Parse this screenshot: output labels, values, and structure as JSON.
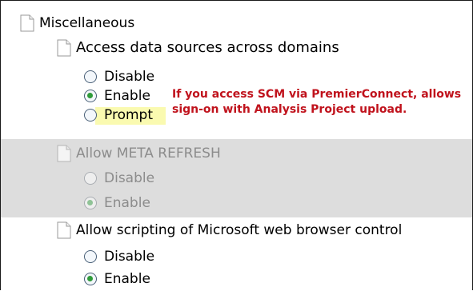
{
  "tree": {
    "root": {
      "label": "Miscellaneous"
    },
    "settings": [
      {
        "label": "Access data sources across domains",
        "options": [
          "Disable",
          "Enable",
          "Prompt"
        ],
        "selected": "Enable"
      },
      {
        "label": "Allow META REFRESH",
        "options": [
          "Disable",
          "Enable"
        ],
        "selected": "Enable",
        "disabled": true
      },
      {
        "label": "Allow scripting of Microsoft web browser control",
        "options": [
          "Disable",
          "Enable"
        ],
        "selected": "Enable"
      }
    ]
  },
  "annotation": {
    "text": "If you access SCM via PremierConnect, allows sign-on with Analysis Project upload.",
    "color": "#c0121c"
  },
  "colors": {
    "highlight": "#fafab0",
    "disabled_band": "#dddddd",
    "radio_checked": "#2f9b3a"
  }
}
